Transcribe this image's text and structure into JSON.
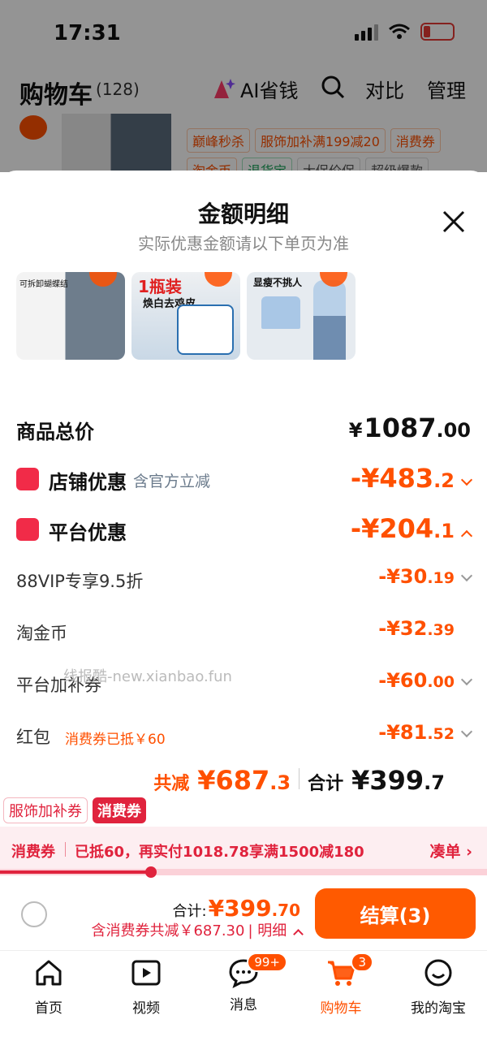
{
  "status_bar": {
    "time": "17:31"
  },
  "header": {
    "title": "购物车",
    "count": "(128)",
    "ai_save": "AI省钱",
    "compare": "对比",
    "manage": "管理"
  },
  "background_item": {
    "tags": [
      "巅峰秒杀",
      "服饰加补满199减20",
      "消费券",
      "淘金币",
      "退货宝",
      "大促价保",
      "超级爆款"
    ]
  },
  "sheet": {
    "title": "金额明细",
    "subtitle": "实际优惠金额请以下单页为准",
    "thumbnails": [
      {
        "caption": "可拆卸蝴蝶结"
      },
      {
        "caption_big": "1瓶装",
        "caption_mid": "焕白去鸡皮"
      },
      {
        "caption": "显瘦不挑人"
      }
    ],
    "rows": {
      "goods_total": {
        "label": "商品总价",
        "currency": "¥",
        "int": "1087",
        "dec": ".00"
      },
      "store_discount": {
        "label": "店铺优惠",
        "note": "含官方立减",
        "int": "-¥483",
        "dec": ".2"
      },
      "platform_discount": {
        "label": "平台优惠",
        "int": "-¥204",
        "dec": ".1"
      },
      "vip": {
        "label": "88VIP专享9.5折",
        "int": "-¥30",
        "dec": ".19"
      },
      "gold_coin": {
        "label": "淘金币",
        "int": "-¥32",
        "dec": ".39"
      },
      "platform_coupon": {
        "label": "平台加补券",
        "int": "-¥60",
        "dec": ".00"
      },
      "red_packet": {
        "label": "红包",
        "note": "消费券已抵￥60",
        "int": "-¥81",
        "dec": ".52"
      }
    },
    "watermark": "线报酷-new.xianbao.fun",
    "summary": {
      "saved_label": "共减",
      "saved_int": "¥687",
      "saved_dec": ".3",
      "total_label": "合计",
      "total_int": "¥399",
      "total_dec": ".7"
    }
  },
  "badges": [
    "服饰加补券",
    "消费券"
  ],
  "promo": {
    "tag": "消费券",
    "message": "已抵60，再实付1018.78享满1500减180",
    "action": "凑单 ›",
    "progress": 0.31
  },
  "checkout": {
    "total_label": "合计:",
    "total_int": "¥399",
    "total_dec": ".70",
    "sub": "含消费券共减￥687.30",
    "detail": "| 明细",
    "pay_button": "结算(3)"
  },
  "tabbar": [
    {
      "label": "首页",
      "icon": "home-icon"
    },
    {
      "label": "视频",
      "icon": "video-icon"
    },
    {
      "label": "消息",
      "icon": "message-icon",
      "badge": "99+"
    },
    {
      "label": "购物车",
      "icon": "cart-icon",
      "badge": "3",
      "active": true
    },
    {
      "label": "我的淘宝",
      "icon": "profile-icon"
    }
  ],
  "colors": {
    "accent": "#ff5000",
    "red": "#e0233d",
    "pay_button": "#ff5a00"
  }
}
